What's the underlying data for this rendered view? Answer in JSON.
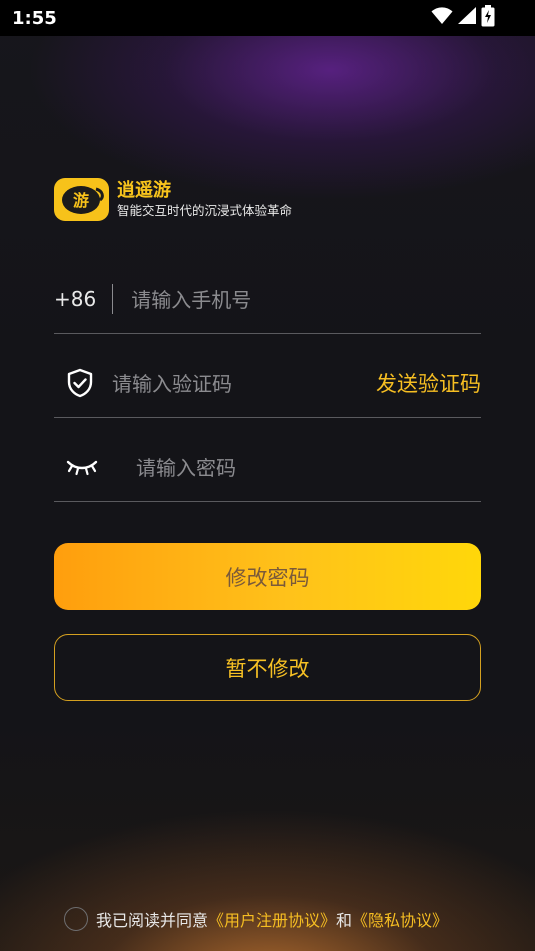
{
  "status_bar": {
    "time": "1:55",
    "icons": [
      "wifi-icon",
      "cell-signal-icon",
      "battery-charging-icon"
    ]
  },
  "brand": {
    "title": "逍遥游",
    "subtitle": "智能交互时代的沉浸式体验革命",
    "badge_text": "游",
    "accent_color": "#f7c21a"
  },
  "phone_field": {
    "prefix": "+86",
    "placeholder": "请输入手机号"
  },
  "code_field": {
    "icon": "shield-check-icon",
    "placeholder": "请输入验证码",
    "send_label": "发送验证码"
  },
  "password_field": {
    "icon": "eye-closed-icon",
    "placeholder": "请输入密码"
  },
  "buttons": {
    "primary_label": "修改密码",
    "secondary_label": "暂不修改"
  },
  "agreement": {
    "prefix": "我已阅读并同意",
    "user_agreement": "《用户注册协议》",
    "conjunction": "和",
    "privacy_policy": "《隐私协议》"
  }
}
